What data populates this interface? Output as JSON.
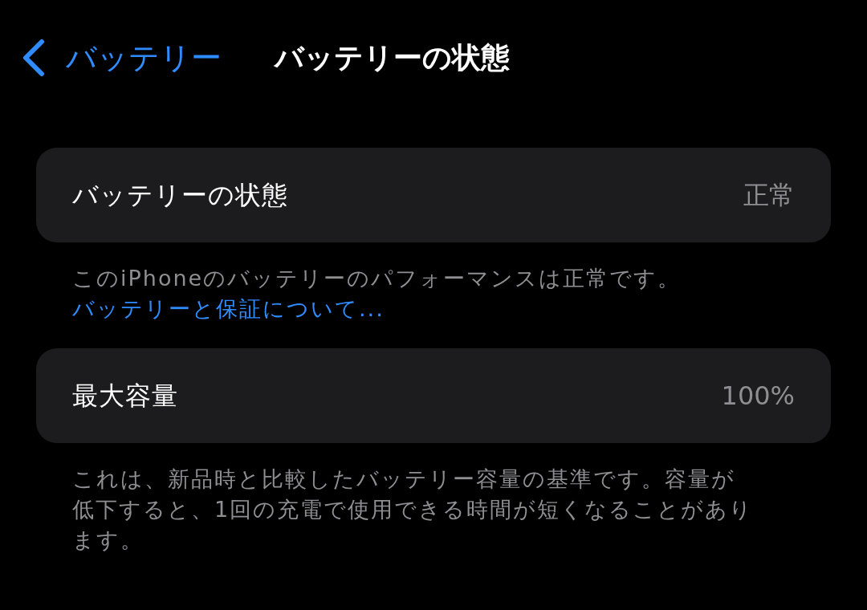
{
  "nav": {
    "back_label": "バッテリー",
    "title": "バッテリーの状態"
  },
  "sections": [
    {
      "label": "バッテリーの状態",
      "value": "正常",
      "footer": "このiPhoneのバッテリーのパフォーマンスは正常です。",
      "link": "バッテリーと保証について..."
    },
    {
      "label": "最大容量",
      "value": "100%",
      "footer": "これは、新品時と比較したバッテリー容量の基準です。容量が低下すると、1回の充電で使用できる時間が短くなることがあります。"
    }
  ]
}
